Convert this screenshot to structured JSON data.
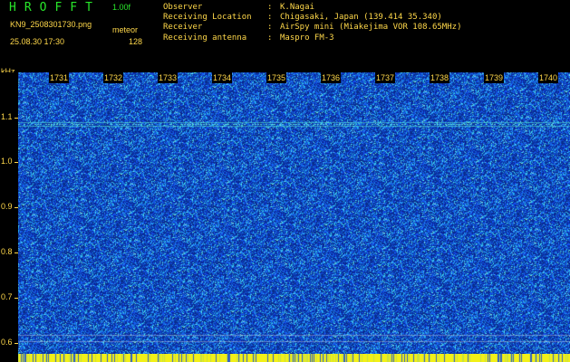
{
  "app": {
    "title": "HROFFT",
    "version": "1.00f",
    "file_name": "KN9_2508301730.png",
    "mode": "meteor",
    "datetime": "25.08.30 17:30",
    "number": "128"
  },
  "info": [
    {
      "key": "Observer",
      "sep": ":",
      "value": "K.Nagai"
    },
    {
      "key": "Receiving Location",
      "sep": ":",
      "value": "Chigasaki, Japan (139.414 35.340)"
    },
    {
      "key": "Receiver",
      "sep": ":",
      "value": "AirSpy mini (Miakejima VOR 108.65MHz)"
    },
    {
      "key": "Receiving antenna",
      "sep": ":",
      "value": "Maspro FM-3"
    }
  ],
  "axis": {
    "unit": "kHz",
    "y_labels": [
      "1.1",
      "1.0",
      "0.9",
      "0.8",
      "0.7",
      "0.6"
    ],
    "time_labels": [
      "1731",
      "1732",
      "1733",
      "1734",
      "1735",
      "1736",
      "1737",
      "1738",
      "1739",
      "1740"
    ]
  },
  "colors": {
    "background": "#000000",
    "label_yellow": "#ffd84a",
    "title_green": "#28e62a",
    "spectrum_base": "#0a2a9a",
    "spectrum_noise": "#2f6cff",
    "spectrum_hot": "#38d8e8",
    "carrier": "#5af0d0",
    "strip_yellow": "#f2f018"
  }
}
